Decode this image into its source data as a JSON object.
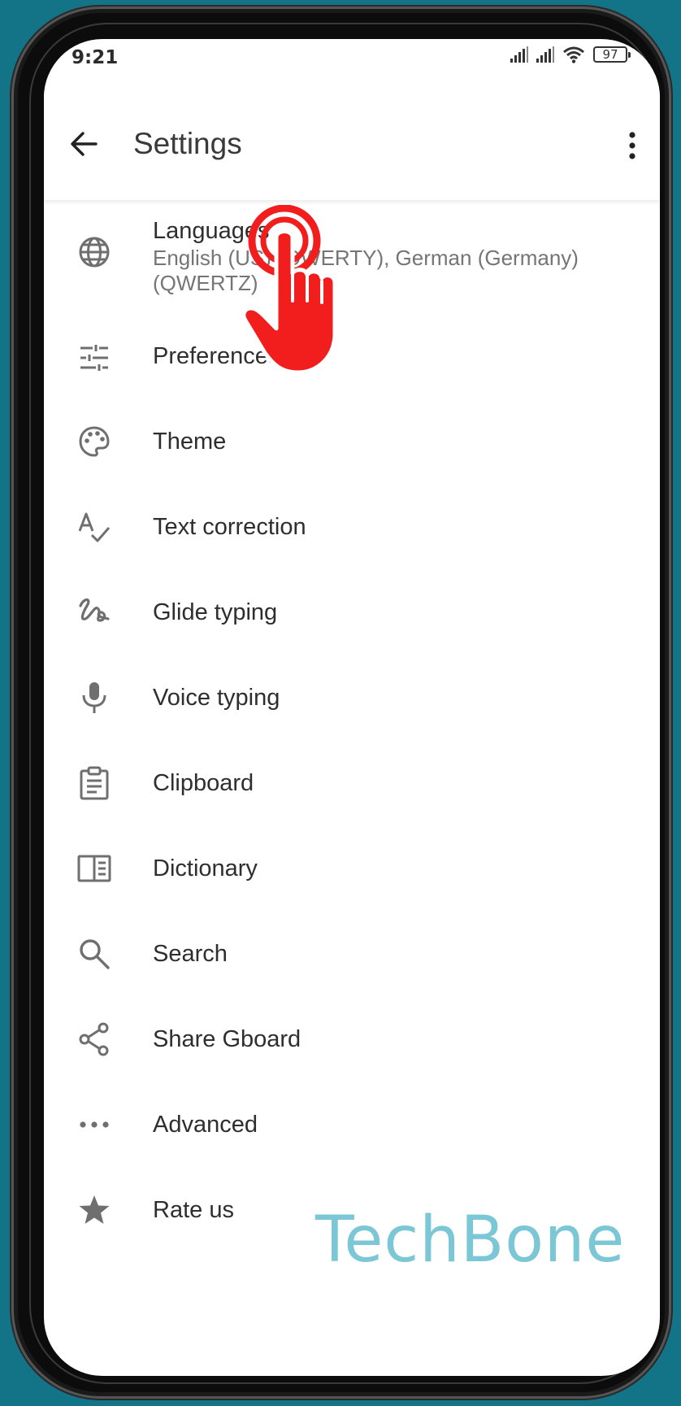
{
  "status": {
    "time": "9:21",
    "battery": "97"
  },
  "header": {
    "title": "Settings"
  },
  "items": [
    {
      "label": "Languages",
      "sub": "English (US) (QWERTY), German (Germany) (QWERTZ)",
      "icon": "globe-icon"
    },
    {
      "label": "Preferences",
      "icon": "tune-icon"
    },
    {
      "label": "Theme",
      "icon": "palette-icon"
    },
    {
      "label": "Text correction",
      "icon": "spellcheck-icon"
    },
    {
      "label": "Glide typing",
      "icon": "gesture-icon"
    },
    {
      "label": "Voice typing",
      "icon": "microphone-icon"
    },
    {
      "label": "Clipboard",
      "icon": "clipboard-icon"
    },
    {
      "label": "Dictionary",
      "icon": "book-icon"
    },
    {
      "label": "Search",
      "icon": "search-icon"
    },
    {
      "label": "Share Gboard",
      "icon": "share-icon"
    },
    {
      "label": "Advanced",
      "icon": "more-horizontal-icon"
    },
    {
      "label": "Rate us",
      "icon": "star-icon"
    }
  ],
  "watermark": "TechBone",
  "colors": {
    "background": "#137387",
    "tap-indicator": "#f21e1e",
    "watermark": "#7cc7d6"
  }
}
